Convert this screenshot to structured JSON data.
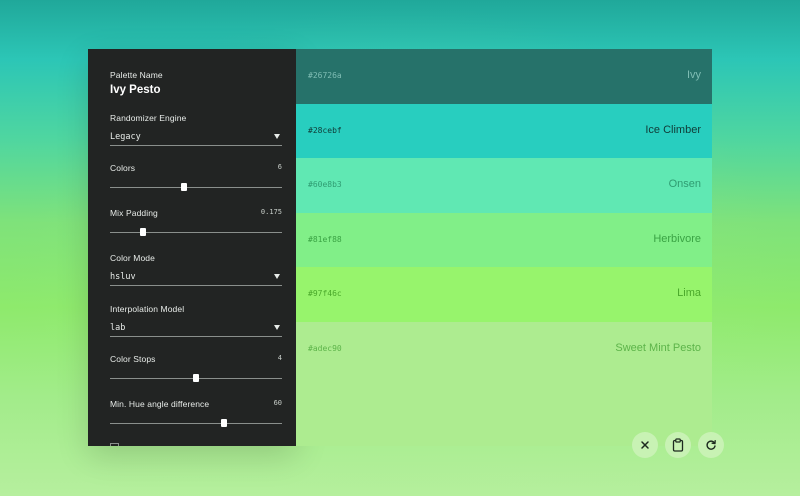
{
  "sidebar": {
    "palette_name_label": "Palette Name",
    "palette_name": "Ivy Pesto",
    "randomizer": {
      "label": "Randomizer Engine",
      "value": "Legacy"
    },
    "colors": {
      "label": "Colors",
      "value": "6",
      "fraction": 0.43
    },
    "mix_padding": {
      "label": "Mix Padding",
      "value": "0.175",
      "fraction": 0.19
    },
    "color_mode": {
      "label": "Color Mode",
      "value": "hsluv"
    },
    "interpolation": {
      "label": "Interpolation Model",
      "value": "lab"
    },
    "color_stops": {
      "label": "Color Stops",
      "value": "4",
      "fraction": 0.5
    },
    "hue_angle": {
      "label": "Min. Hue angle difference",
      "value": "60",
      "fraction": 0.66
    }
  },
  "swatches": [
    {
      "hex": "#26726a",
      "name": "Ivy",
      "bg": "#26726a",
      "fg": "#7fbdb4"
    },
    {
      "hex": "#28cebf",
      "name": "Ice Climber",
      "bg": "#28cebf",
      "fg": "#103b37"
    },
    {
      "hex": "#60e8b3",
      "name": "Onsen",
      "bg": "#60e8b3",
      "fg": "#2f9c72"
    },
    {
      "hex": "#81ef88",
      "name": "Herbivore",
      "bg": "#81ef88",
      "fg": "#3aa344"
    },
    {
      "hex": "#97f46c",
      "name": "Lima",
      "bg": "#97f46c",
      "fg": "#4aa82a"
    },
    {
      "hex": "#adec90",
      "name": "Sweet Mint Pesto",
      "bg": "#adec90",
      "fg": "#5db44a"
    }
  ],
  "actions": {
    "close_icon": "close-icon",
    "copy_icon": "clipboard-icon",
    "refresh_icon": "refresh-icon"
  }
}
